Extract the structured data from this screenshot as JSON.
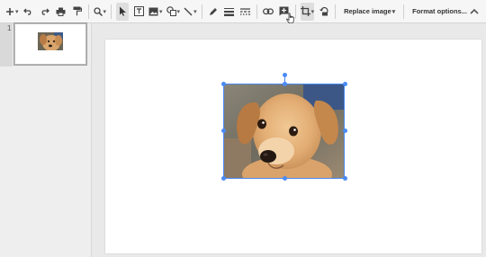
{
  "toolbar": {
    "replace_image_label": "Replace image",
    "format_options_label": "Format options...",
    "accent": "#4a8af4"
  },
  "filmstrip": {
    "slides": [
      {
        "number": "1"
      }
    ]
  },
  "canvas": {
    "image": {
      "subject": "puppy",
      "selected": true
    }
  }
}
